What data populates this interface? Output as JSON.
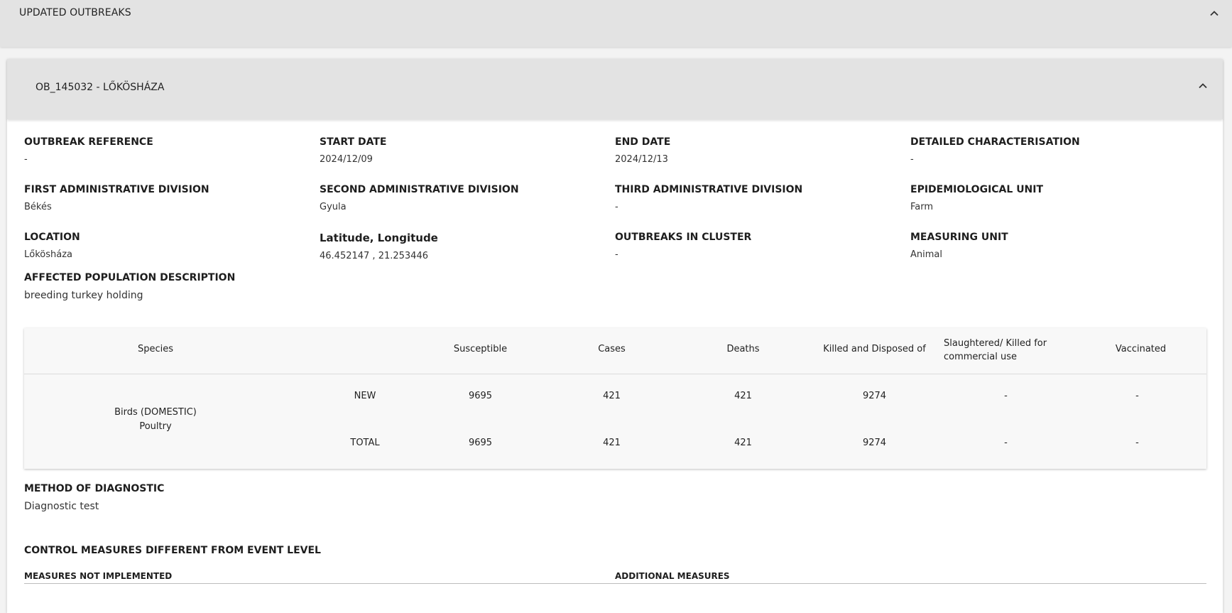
{
  "section": {
    "title": "UPDATED OUTBREAKS"
  },
  "outbreak": {
    "title": "OB_145032 - LŐKÖSHÁZA",
    "fields": [
      {
        "label": "OUTBREAK REFERENCE",
        "value": "-"
      },
      {
        "label": "START DATE",
        "value": "2024/12/09"
      },
      {
        "label": "END DATE",
        "value": "2024/12/13"
      },
      {
        "label": "DETAILED CHARACTERISATION",
        "value": "-"
      },
      {
        "label": "FIRST ADMINISTRATIVE DIVISION",
        "value": "Békés"
      },
      {
        "label": "SECOND ADMINISTRATIVE DIVISION",
        "value": "Gyula"
      },
      {
        "label": "THIRD ADMINISTRATIVE DIVISION",
        "value": "-"
      },
      {
        "label": "EPIDEMIOLOGICAL UNIT",
        "value": "Farm"
      },
      {
        "label": "LOCATION",
        "value": "Lőkösháza"
      },
      {
        "label": "Latitude, Longitude",
        "value": "46.452147 , 21.253446"
      },
      {
        "label": "OUTBREAKS IN CLUSTER",
        "value": "-"
      },
      {
        "label": "MEASURING UNIT",
        "value": "Animal"
      },
      {
        "label": "AFFECTED POPULATION DESCRIPTION",
        "value": "breeding turkey holding"
      }
    ],
    "table": {
      "headers": {
        "species": "Species",
        "susceptible": "Susceptible",
        "cases": "Cases",
        "deaths": "Deaths",
        "killed": "Killed and Disposed of",
        "slaughtered": "Slaughtered/ Killed for commercial use",
        "vaccinated": "Vaccinated"
      },
      "species_line1": "Birds (DOMESTIC)",
      "species_line2": "Poultry",
      "rows": [
        {
          "type": "NEW",
          "susceptible": "9695",
          "cases": "421",
          "deaths": "421",
          "killed": "9274",
          "slaughtered": "-",
          "vaccinated": "-"
        },
        {
          "type": "TOTAL",
          "susceptible": "9695",
          "cases": "421",
          "deaths": "421",
          "killed": "9274",
          "slaughtered": "-",
          "vaccinated": "-"
        }
      ]
    },
    "diagnostic": {
      "label": "METHOD OF DIAGNOSTIC",
      "value": "Diagnostic test"
    },
    "control": {
      "title": "CONTROL MEASURES DIFFERENT FROM EVENT LEVEL",
      "not_implemented": "MEASURES NOT IMPLEMENTED",
      "additional": "ADDITIONAL MEASURES"
    }
  }
}
